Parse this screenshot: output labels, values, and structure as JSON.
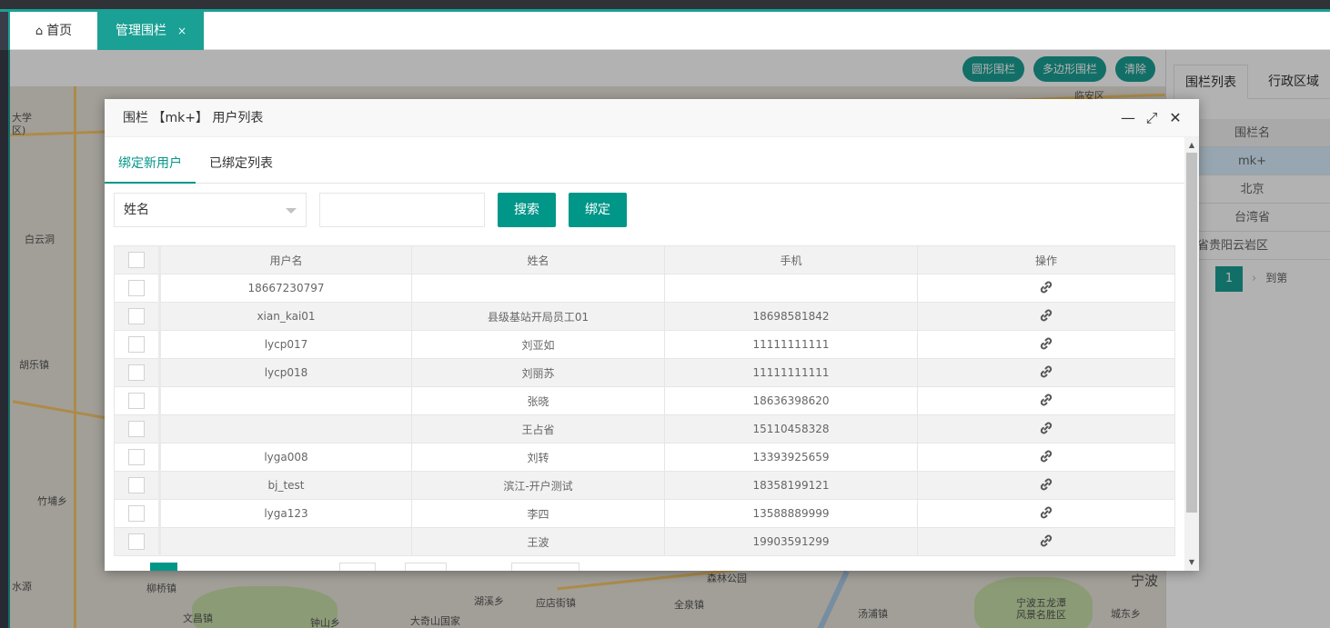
{
  "tabs": {
    "home_label": "首页",
    "active_label": "管理围栏",
    "close_glyph": "×"
  },
  "map_buttons": [
    "圆形围栏",
    "多边形围栏",
    "清除"
  ],
  "map_labels": [
    "大学",
    "区)",
    "白云洞",
    "胡乐镇",
    "竹埔乡",
    "水源",
    "文昌镇",
    "森林公园",
    "宁波",
    "大奇山国家",
    "宁波五龙潭",
    "风景名胜区",
    "全泉镇",
    "湖溪乡",
    "应店街镇",
    "钟山乡",
    "汤浦镇",
    "城东乡",
    "柳桥镇",
    "临安区"
  ],
  "right_panel": {
    "tabs": [
      "围栏列表",
      "行政区域"
    ],
    "header": "围栏名",
    "rows": [
      "mk+",
      "北京",
      "台湾省",
      "贵州省贵阳云岩区"
    ],
    "page": "1",
    "goto_label": "到第"
  },
  "modal": {
    "title": "围栏 【mk+】 用户列表",
    "min_glyph": "—",
    "max_glyph": "⤢",
    "close_glyph": "✕",
    "tabs": [
      "绑定新用户",
      "已绑定列表"
    ],
    "search": {
      "field_selected": "姓名",
      "input_value": "",
      "search_label": "搜索",
      "bind_label": "绑定"
    },
    "columns": [
      "用户名",
      "姓名",
      "手机",
      "操作"
    ],
    "rows": [
      {
        "username": "18667230797",
        "name": "",
        "phone": ""
      },
      {
        "username": "xian_kai01",
        "name": "县级基站开局员工01",
        "phone": "18698581842"
      },
      {
        "username": "lycp017",
        "name": "刘亚如",
        "phone": "11111111111"
      },
      {
        "username": "lycp018",
        "name": "刘丽苏",
        "phone": "11111111111"
      },
      {
        "username": "",
        "name": "张晓",
        "phone": "18636398620"
      },
      {
        "username": "",
        "name": "王占省",
        "phone": "15110458328"
      },
      {
        "username": "lyga008",
        "name": "刘转",
        "phone": "13393925659"
      },
      {
        "username": "bj_test",
        "name": "滨江-开户测试",
        "phone": "18358199121"
      },
      {
        "username": "lyga123",
        "name": "李四",
        "phone": "13588889999"
      },
      {
        "username": "",
        "name": "王波",
        "phone": "19903591299"
      }
    ],
    "row_action_icon": "link-icon"
  },
  "colors": {
    "accent": "#009688",
    "tab_accent": "#1aa094"
  }
}
